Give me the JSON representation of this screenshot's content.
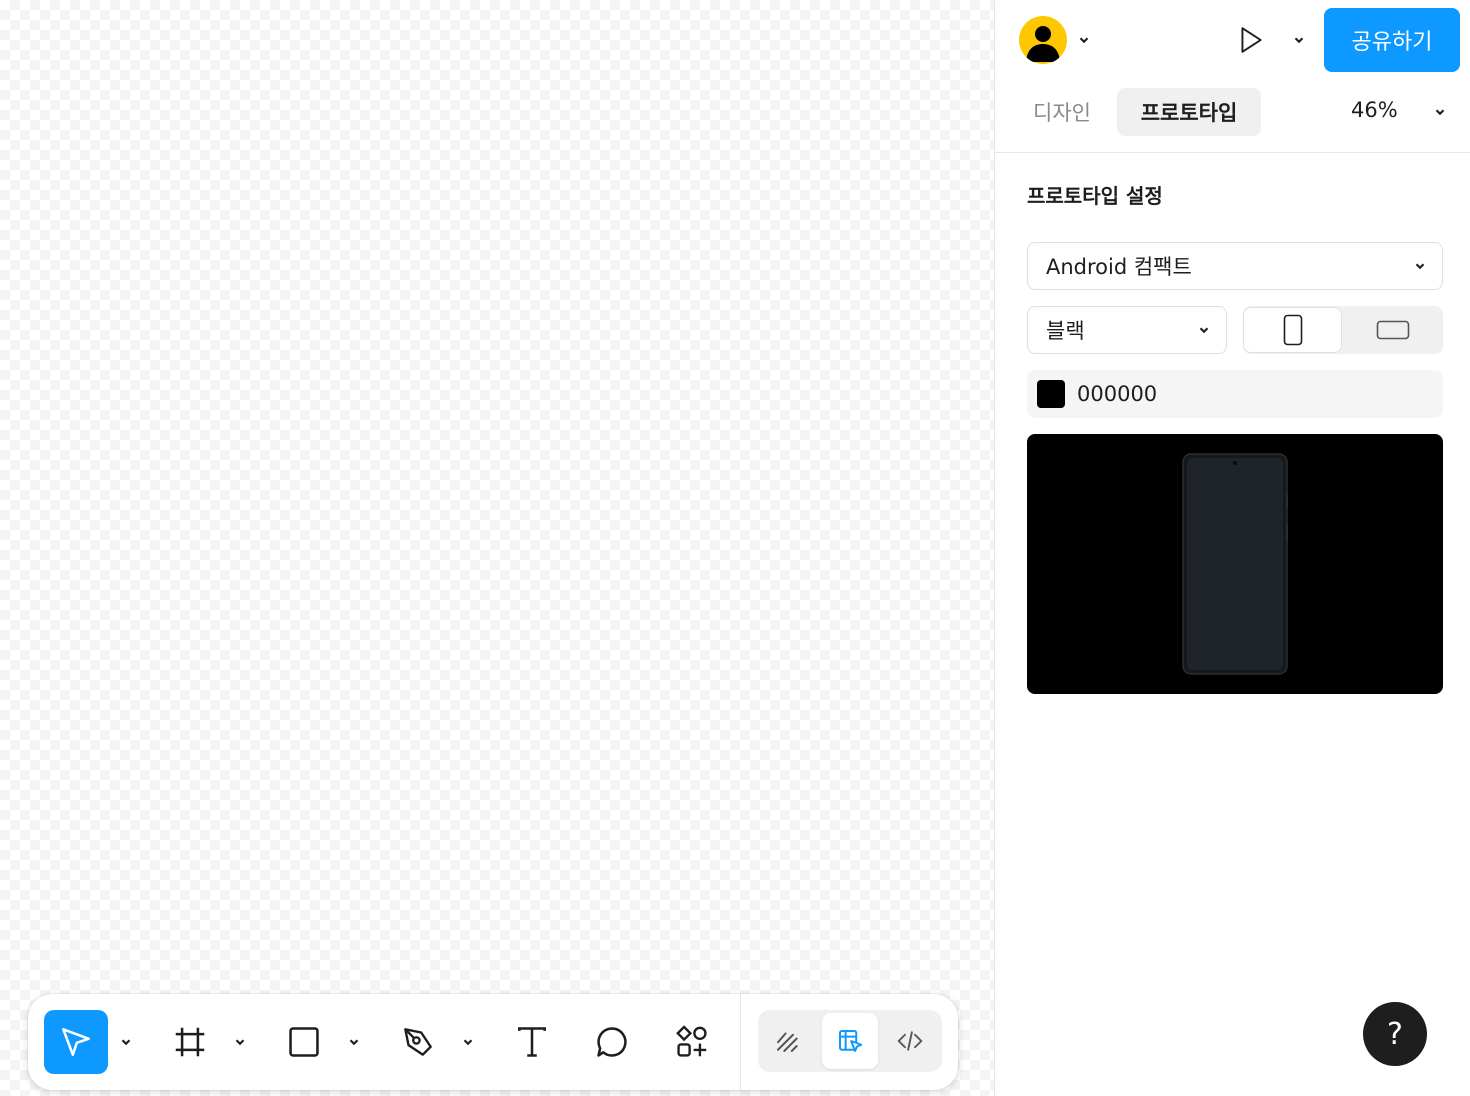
{
  "header": {
    "share_label": "공유하기"
  },
  "tabs": {
    "design": "디자인",
    "prototype": "프로토타입",
    "zoom": "46%"
  },
  "prototype_settings": {
    "title": "프로토타입 설정",
    "device": "Android 컴팩트",
    "frame_color": "블랙",
    "orientation": "portrait",
    "background_hex": "000000"
  },
  "toolbar": {
    "active_tool": "move",
    "active_mode": "prototype",
    "tools": [
      "move",
      "frame",
      "rectangle",
      "pen",
      "text",
      "comment",
      "actions"
    ],
    "modes": [
      "draw",
      "prototype",
      "dev"
    ]
  },
  "help_label": "?",
  "colors": {
    "accent": "#0d99ff",
    "avatar": "#ffc700",
    "preview_bg": "#000000"
  }
}
